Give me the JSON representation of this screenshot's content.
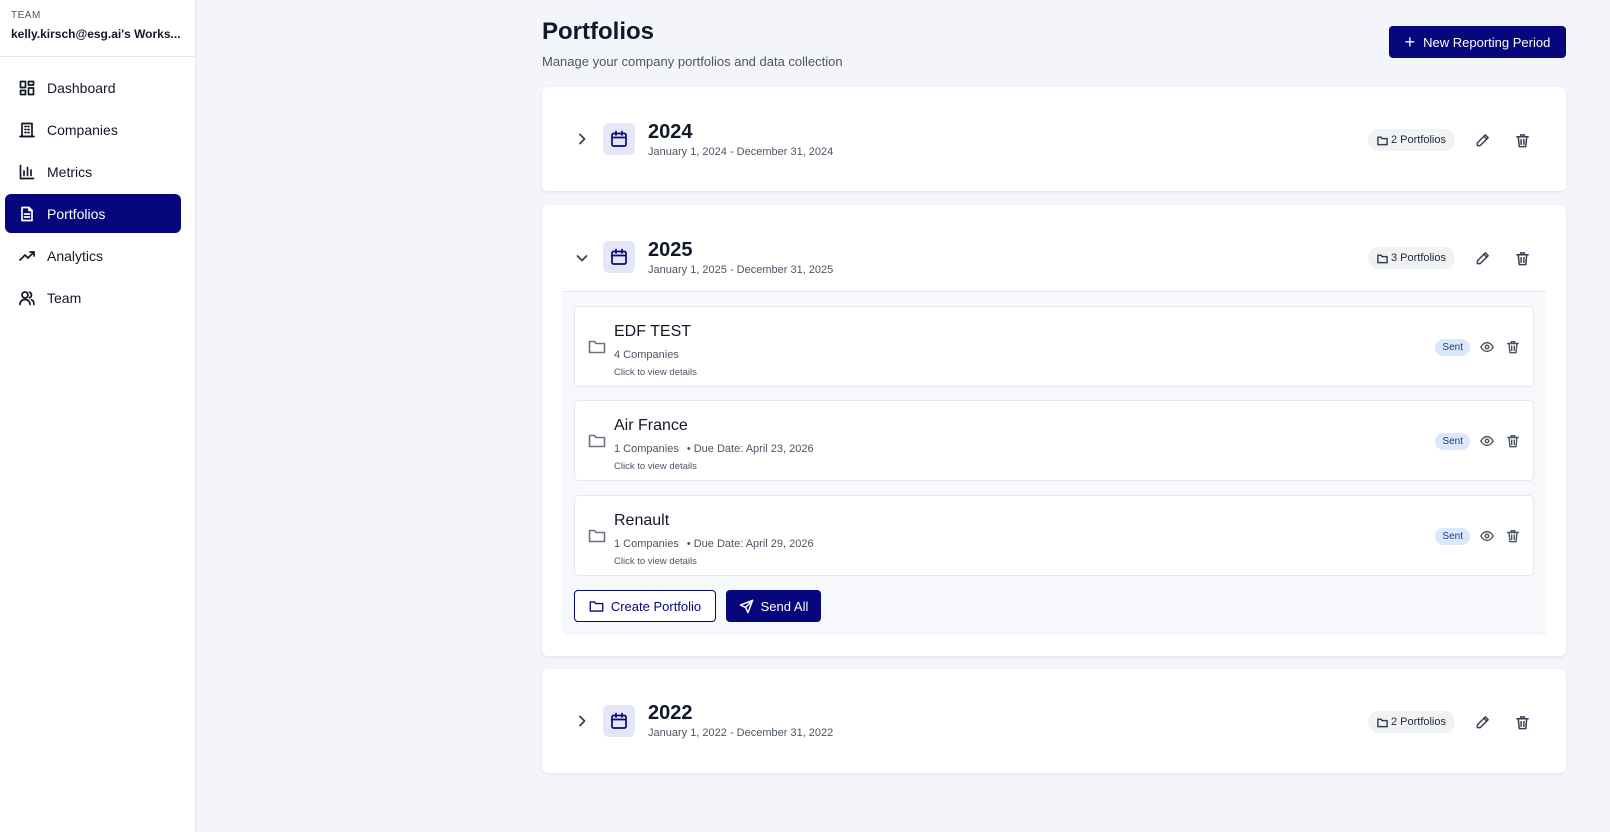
{
  "sidebar": {
    "team_label": "TEAM",
    "team_name": "kelly.kirsch@esg.ai's Works...",
    "items": [
      {
        "label": "Dashboard",
        "icon": "dashboard-icon"
      },
      {
        "label": "Companies",
        "icon": "building-icon"
      },
      {
        "label": "Metrics",
        "icon": "bar-chart-icon"
      },
      {
        "label": "Portfolios",
        "icon": "document-icon",
        "active": true
      },
      {
        "label": "Analytics",
        "icon": "trending-up-icon"
      },
      {
        "label": "Team",
        "icon": "users-icon"
      }
    ]
  },
  "header": {
    "title": "Portfolios",
    "subtitle": "Manage your company portfolios and data collection",
    "new_period_label": "New Reporting Period"
  },
  "periods": [
    {
      "year": "2024",
      "range": "January 1, 2024 - December 31, 2024",
      "count": "2 Portfolios",
      "expanded": false
    },
    {
      "year": "2025",
      "range": "January 1, 2025 - December 31, 2025",
      "count": "3 Portfolios",
      "expanded": true,
      "portfolios": [
        {
          "name": "EDF TEST",
          "companies": "4 Companies",
          "due": "",
          "hint": "Click to view details",
          "status": "Sent"
        },
        {
          "name": "Air France",
          "companies": "1 Companies",
          "due": "• Due Date: April 23, 2026",
          "hint": "Click to view details",
          "status": "Sent"
        },
        {
          "name": "Renault",
          "companies": "1 Companies",
          "due": "• Due Date: April 29, 2026",
          "hint": "Click to view details",
          "status": "Sent"
        }
      ],
      "create_label": "Create Portfolio",
      "send_label": "Send All"
    },
    {
      "year": "2022",
      "range": "January 1, 2022 - December 31, 2022",
      "count": "2 Portfolios",
      "expanded": false
    }
  ],
  "colors": {
    "accent": "#06067d",
    "background": "#f4f5fb",
    "sent_badge_bg": "#dbe7fb"
  }
}
